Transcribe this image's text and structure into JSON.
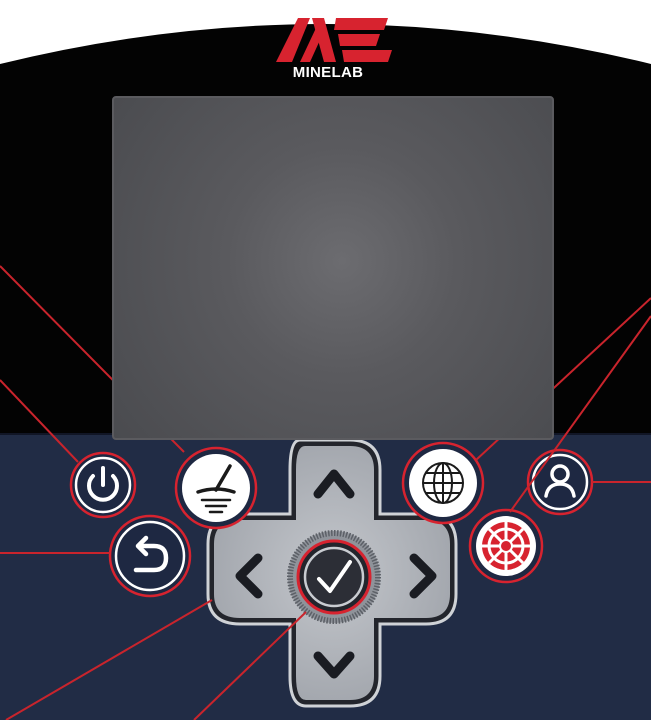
{
  "device": {
    "brand": "MINELAB",
    "colors": {
      "body_top": "#030303",
      "body_bottom": "#212c45",
      "screen": "#58585c",
      "accent_red": "#d7232f",
      "callout_line": "#c9242c",
      "button_face": "#ffffff",
      "button_ring": "#1e2842",
      "dpad_grey": "#a9adb4",
      "select_dark": "#23252c"
    },
    "screen": {
      "state": "off"
    },
    "buttons": [
      {
        "id": "power",
        "icon": "power-icon"
      },
      {
        "id": "detect-mode",
        "icon": "coil-icon"
      },
      {
        "id": "back",
        "icon": "back-arrow-icon"
      },
      {
        "id": "settings",
        "icon": "globe-icon"
      },
      {
        "id": "user-profile",
        "icon": "user-icon"
      },
      {
        "id": "pinpoint",
        "icon": "pinpoint-target-icon"
      }
    ],
    "dpad": {
      "up": "chevron-up-icon",
      "down": "chevron-down-icon",
      "left": "chevron-left-icon",
      "right": "chevron-right-icon",
      "center": "check-icon"
    }
  }
}
